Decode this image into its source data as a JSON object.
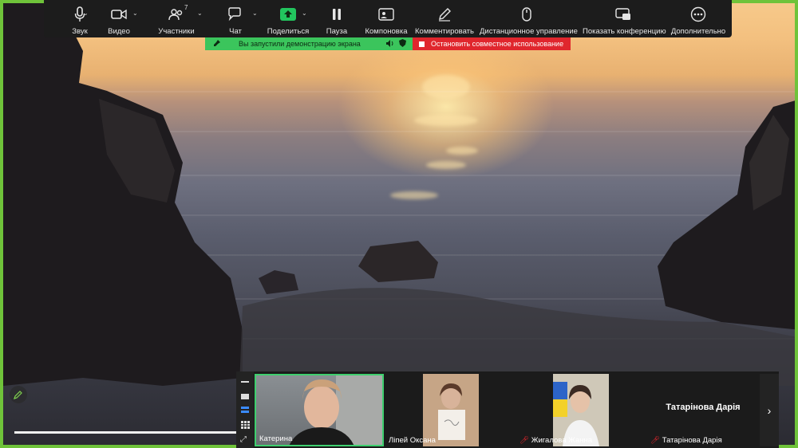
{
  "toolbar": {
    "items": [
      {
        "label": "Звук",
        "icon": "microphone-icon"
      },
      {
        "label": "Видео",
        "icon": "video-camera-icon"
      },
      {
        "label": "Участники",
        "icon": "participants-icon",
        "count": "7"
      },
      {
        "label": "Чат",
        "icon": "chat-icon"
      },
      {
        "label": "Поделиться",
        "icon": "share-screen-icon"
      },
      {
        "label": "Пауза",
        "icon": "pause-icon"
      },
      {
        "label": "Компоновка",
        "icon": "layout-icon"
      },
      {
        "label": "Комментировать",
        "icon": "annotate-pen-icon"
      },
      {
        "label": "Дистанционное управление",
        "icon": "remote-mouse-icon"
      },
      {
        "label": "Показать конференцию",
        "icon": "show-meeting-icon"
      },
      {
        "label": "Дополнительно",
        "icon": "more-icon"
      }
    ]
  },
  "status": {
    "sharing_text": "Вы запустили демонстрацию экрана",
    "stop_text": "Остановить совместное использование",
    "sharing_color": "#3bc55c",
    "stop_color": "#e0262d"
  },
  "participants": [
    {
      "name": "Катерина",
      "muted": false,
      "active_speaker": true
    },
    {
      "name": "Лiпей Оксана",
      "muted": false,
      "active_speaker": false
    },
    {
      "name": "Жигалова Жанна",
      "muted": true,
      "active_speaker": false
    },
    {
      "name": "Татарінова Дарія",
      "muted": true,
      "video_off": true
    }
  ],
  "colors": {
    "frame_border": "#6fc33a",
    "toolbar_bg": "#1c1c1c",
    "share_button": "#22c55e",
    "active_speaker_border": "#3ecf6e"
  }
}
